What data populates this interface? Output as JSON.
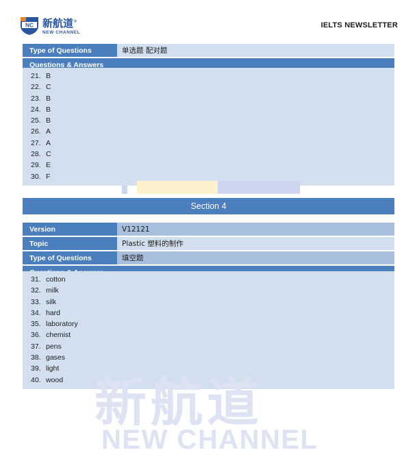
{
  "header": {
    "brand_cn": "新航道",
    "brand_tm": "®",
    "brand_en": "NEW CHANNEL",
    "logo_mark": "NC",
    "newsletter_title": "IELTS NEWSLETTER"
  },
  "section3": {
    "type_label": "Type of Questions",
    "type_value": "单选题 配对题",
    "qa_label": "Questions & Answers",
    "answers": [
      {
        "num": "21.",
        "value": "B"
      },
      {
        "num": "22.",
        "value": "C"
      },
      {
        "num": "23.",
        "value": "B"
      },
      {
        "num": "24.",
        "value": "B"
      },
      {
        "num": "25.",
        "value": "B"
      },
      {
        "num": "26.",
        "value": "A"
      },
      {
        "num": "27.",
        "value": "A"
      },
      {
        "num": "28.",
        "value": "C"
      },
      {
        "num": "29.",
        "value": "E"
      },
      {
        "num": "30.",
        "value": "F"
      }
    ]
  },
  "section4": {
    "title": "Section 4",
    "version_label": "Version",
    "version_value": "V12121",
    "topic_label": "Topic",
    "topic_value": "Plastic 塑料的制作",
    "type_label": "Type of Questions",
    "type_value": "填空题",
    "qa_label": "Questions & Answers",
    "answers": [
      {
        "num": "31.",
        "value": "cotton"
      },
      {
        "num": "32.",
        "value": "milk"
      },
      {
        "num": "33.",
        "value": "silk"
      },
      {
        "num": "34.",
        "value": "hard"
      },
      {
        "num": "35.",
        "value": "laboratory"
      },
      {
        "num": "36.",
        "value": "chemist"
      },
      {
        "num": "37.",
        "value": "pens"
      },
      {
        "num": "38.",
        "value": "gases"
      },
      {
        "num": "39.",
        "value": "light"
      },
      {
        "num": "40.",
        "value": "wood"
      }
    ]
  },
  "watermark": {
    "cn": "新航道",
    "en": "NEW CHANNEL"
  },
  "colors": {
    "header_blue": "#4a7ebc",
    "value_blue": "#a8c0de",
    "body_blue": "#d2dfee",
    "cream": "#fbf2cd",
    "lavender": "#ccd6ee",
    "brand_blue": "#2b56a0",
    "watermark_blue": "#dde3f2"
  }
}
